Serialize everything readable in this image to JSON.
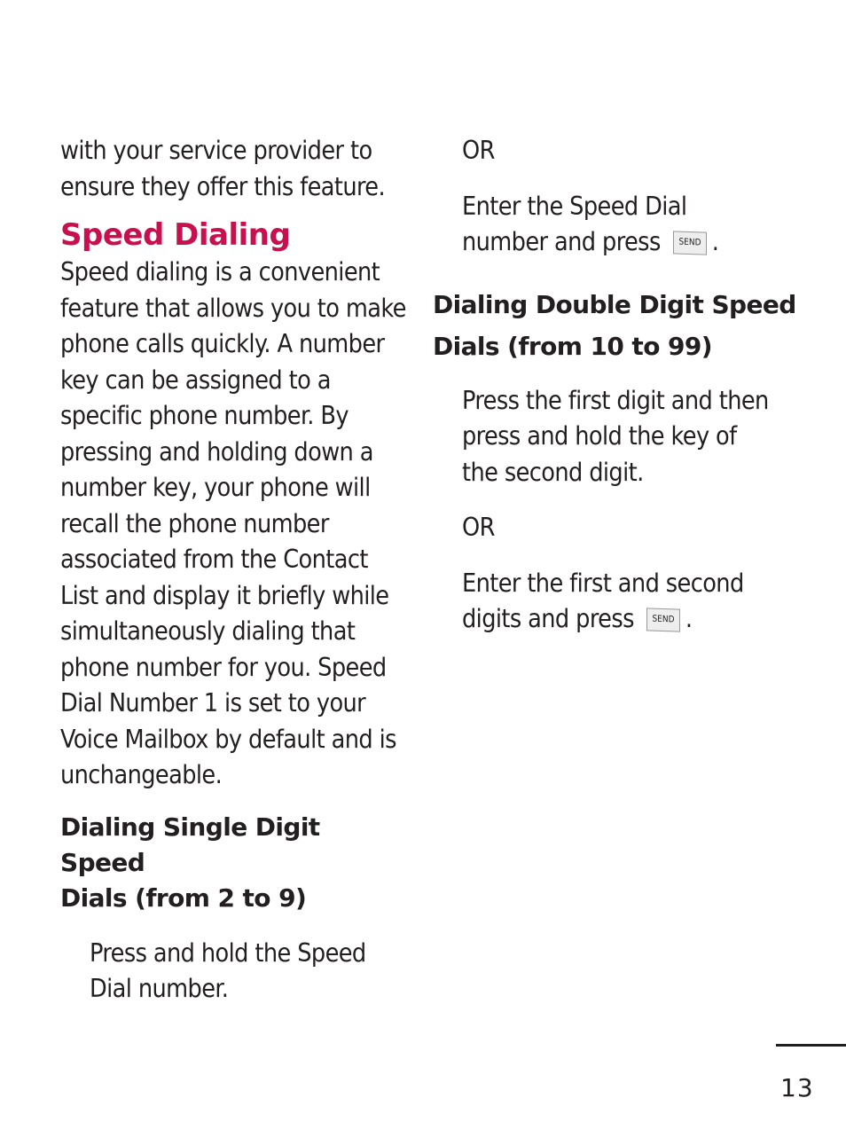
{
  "left": {
    "intro": [
      "with your service provider to",
      "ensure they offer this feature."
    ],
    "section_title": "Speed Dialing",
    "body": [
      "Speed dialing is a convenient",
      "feature that allows you to make",
      "phone calls quickly. A number",
      "key can be assigned to a",
      "specific phone number. By",
      "pressing and holding down a",
      "number key, your phone will",
      "recall the phone number",
      "associated from the Contact",
      "List and display it briefly while",
      "simultaneously dialing that",
      "phone number for you. Speed",
      "Dial Number 1 is set to your",
      "Voice Mailbox by default and is",
      "unchangeable."
    ],
    "sub1_title": [
      "Dialing Single Digit Speed",
      "Dials (from 2 to 9)"
    ],
    "sub1_step": [
      "Press and hold the Speed",
      "Dial number."
    ]
  },
  "right": {
    "or1": "OR",
    "step_alt1": [
      "Enter the Speed Dial",
      "number and press"
    ],
    "send_key": "SEND",
    "period": ".",
    "sub2_title": [
      "Dialing Double Digit Speed",
      "Dials (from 10 to 99)"
    ],
    "sub2_step": [
      "Press the first digit and then",
      "press and hold the key of",
      "the second digit."
    ],
    "or2": "OR",
    "step_alt2": [
      "Enter the first and second",
      "digits and press"
    ]
  },
  "page_number": "13"
}
